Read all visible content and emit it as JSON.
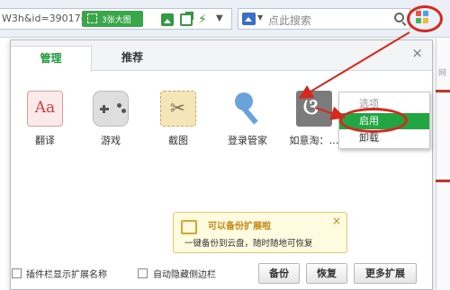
{
  "toolbar": {
    "url_text": "W3h&id=39017(",
    "screenshot_label": "3张大图",
    "search_placeholder": "点此搜索"
  },
  "background": {
    "side_text": "网"
  },
  "panel": {
    "tabs": [
      {
        "label": "管理"
      },
      {
        "label": "推荐"
      }
    ],
    "close_glyph": "×",
    "apps": [
      {
        "label": "翻译",
        "icon": "translate-icon",
        "glyph": "Aa"
      },
      {
        "label": "游戏",
        "icon": "gamepad-icon"
      },
      {
        "label": "截图",
        "icon": "scissors-icon",
        "glyph": "✂"
      },
      {
        "label": "登录管家",
        "icon": "key-icon"
      },
      {
        "label": "如意淘：…",
        "icon": "ruyitao-icon",
        "glyph": "ଓ"
      }
    ]
  },
  "context_menu": {
    "title": "选项",
    "enable": "启用",
    "uninstall": "卸载"
  },
  "tooltip": {
    "title": "可以备份扩展啦",
    "body": "一键备份到云盘，随时随地可恢复",
    "close_glyph": "×"
  },
  "bottom_bar": {
    "show_names_label": "插件栏显示扩展名称",
    "auto_hide_label": "自动隐藏侧边栏",
    "backup_label": "备份",
    "restore_label": "恢复",
    "more_label": "更多扩展"
  },
  "colors": {
    "accent_green": "#24a543",
    "annotation_red": "#d7281d"
  }
}
